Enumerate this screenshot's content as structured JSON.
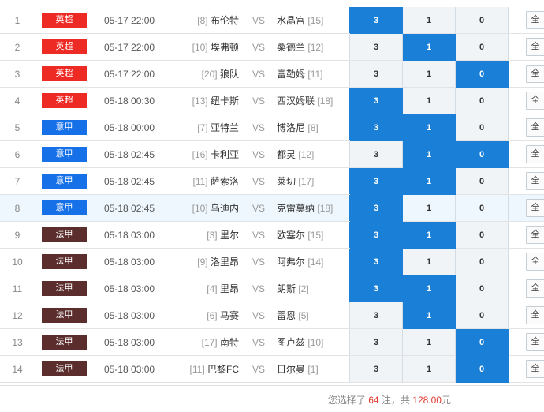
{
  "colors": {
    "premier_league": "#ee2a24",
    "serie_a": "#1670e8",
    "ligue_1": "#5b2d2d",
    "selected_odd": "#1a7fd6",
    "highlight_row": "#eef7fd"
  },
  "matches": [
    {
      "num": "1",
      "league": "英超",
      "league_color": "#ee2a24",
      "time": "05-17 22:00",
      "home_rank": "[8]",
      "home": "布伦特",
      "vs": "VS",
      "away": "水晶宫",
      "away_rank": "[15]",
      "odds": [
        "3",
        "1",
        "0"
      ],
      "selected": [
        true,
        false,
        false
      ],
      "all": "全",
      "highlight": false
    },
    {
      "num": "2",
      "league": "英超",
      "league_color": "#ee2a24",
      "time": "05-17 22:00",
      "home_rank": "[10]",
      "home": "埃弗顿",
      "vs": "VS",
      "away": "桑德兰",
      "away_rank": "[12]",
      "odds": [
        "3",
        "1",
        "0"
      ],
      "selected": [
        false,
        true,
        false
      ],
      "all": "全",
      "highlight": false
    },
    {
      "num": "3",
      "league": "英超",
      "league_color": "#ee2a24",
      "time": "05-17 22:00",
      "home_rank": "[20]",
      "home": "狼队",
      "vs": "VS",
      "away": "富勒姆",
      "away_rank": "[11]",
      "odds": [
        "3",
        "1",
        "0"
      ],
      "selected": [
        false,
        false,
        true
      ],
      "all": "全",
      "highlight": false
    },
    {
      "num": "4",
      "league": "英超",
      "league_color": "#ee2a24",
      "time": "05-18 00:30",
      "home_rank": "[13]",
      "home": "纽卡斯",
      "vs": "VS",
      "away": "西汉姆联",
      "away_rank": "[18]",
      "odds": [
        "3",
        "1",
        "0"
      ],
      "selected": [
        true,
        false,
        false
      ],
      "all": "全",
      "highlight": false
    },
    {
      "num": "5",
      "league": "意甲",
      "league_color": "#1670e8",
      "time": "05-18 00:00",
      "home_rank": "[7]",
      "home": "亚特兰",
      "vs": "VS",
      "away": "博洛尼",
      "away_rank": "[8]",
      "odds": [
        "3",
        "1",
        "0"
      ],
      "selected": [
        true,
        true,
        false
      ],
      "all": "全",
      "highlight": false
    },
    {
      "num": "6",
      "league": "意甲",
      "league_color": "#1670e8",
      "time": "05-18 02:45",
      "home_rank": "[16]",
      "home": "卡利亚",
      "vs": "VS",
      "away": "都灵",
      "away_rank": "[12]",
      "odds": [
        "3",
        "1",
        "0"
      ],
      "selected": [
        false,
        true,
        true
      ],
      "all": "全",
      "highlight": false
    },
    {
      "num": "7",
      "league": "意甲",
      "league_color": "#1670e8",
      "time": "05-18 02:45",
      "home_rank": "[11]",
      "home": "萨索洛",
      "vs": "VS",
      "away": "莱切",
      "away_rank": "[17]",
      "odds": [
        "3",
        "1",
        "0"
      ],
      "selected": [
        true,
        true,
        false
      ],
      "all": "全",
      "highlight": false
    },
    {
      "num": "8",
      "league": "意甲",
      "league_color": "#1670e8",
      "time": "05-18 02:45",
      "home_rank": "[10]",
      "home": "乌迪内",
      "vs": "VS",
      "away": "克雷莫纳",
      "away_rank": "[18]",
      "odds": [
        "3",
        "1",
        "0"
      ],
      "selected": [
        true,
        false,
        false
      ],
      "all": "全",
      "highlight": true
    },
    {
      "num": "9",
      "league": "法甲",
      "league_color": "#5b2d2d",
      "time": "05-18 03:00",
      "home_rank": "[3]",
      "home": "里尔",
      "vs": "VS",
      "away": "欧塞尔",
      "away_rank": "[15]",
      "odds": [
        "3",
        "1",
        "0"
      ],
      "selected": [
        true,
        true,
        false
      ],
      "all": "全",
      "highlight": false
    },
    {
      "num": "10",
      "league": "法甲",
      "league_color": "#5b2d2d",
      "time": "05-18 03:00",
      "home_rank": "[9]",
      "home": "洛里昂",
      "vs": "VS",
      "away": "阿弗尔",
      "away_rank": "[14]",
      "odds": [
        "3",
        "1",
        "0"
      ],
      "selected": [
        true,
        false,
        false
      ],
      "all": "全",
      "highlight": false
    },
    {
      "num": "11",
      "league": "法甲",
      "league_color": "#5b2d2d",
      "time": "05-18 03:00",
      "home_rank": "[4]",
      "home": "里昂",
      "vs": "VS",
      "away": "朗斯",
      "away_rank": "[2]",
      "odds": [
        "3",
        "1",
        "0"
      ],
      "selected": [
        true,
        true,
        false
      ],
      "all": "全",
      "highlight": false
    },
    {
      "num": "12",
      "league": "法甲",
      "league_color": "#5b2d2d",
      "time": "05-18 03:00",
      "home_rank": "[6]",
      "home": "马赛",
      "vs": "VS",
      "away": "雷恩",
      "away_rank": "[5]",
      "odds": [
        "3",
        "1",
        "0"
      ],
      "selected": [
        false,
        true,
        false
      ],
      "all": "全",
      "highlight": false
    },
    {
      "num": "13",
      "league": "法甲",
      "league_color": "#5b2d2d",
      "time": "05-18 03:00",
      "home_rank": "[17]",
      "home": "南特",
      "vs": "VS",
      "away": "图卢兹",
      "away_rank": "[10]",
      "odds": [
        "3",
        "1",
        "0"
      ],
      "selected": [
        false,
        false,
        true
      ],
      "all": "全",
      "highlight": false
    },
    {
      "num": "14",
      "league": "法甲",
      "league_color": "#5b2d2d",
      "time": "05-18 03:00",
      "home_rank": "[11]",
      "home": "巴黎FC",
      "vs": "VS",
      "away": "日尔曼",
      "away_rank": "[1]",
      "odds": [
        "3",
        "1",
        "0"
      ],
      "selected": [
        false,
        false,
        true
      ],
      "all": "全",
      "highlight": false
    }
  ],
  "summary": {
    "prefix": "您选择了",
    "count": "64",
    "mid": "注，共",
    "amount": "128.00",
    "suffix": "元"
  }
}
